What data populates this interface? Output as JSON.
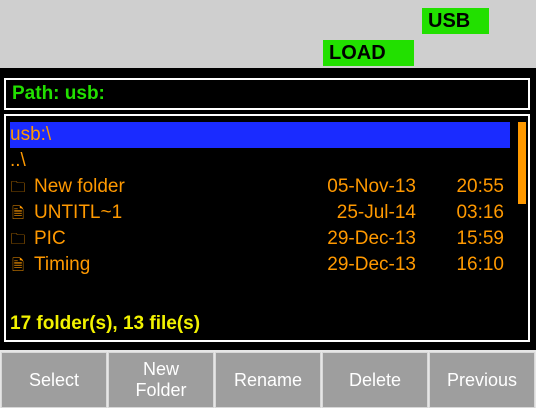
{
  "status": {
    "usb": "USB",
    "load": "LOAD"
  },
  "path": {
    "label": "Path:",
    "value": "usb:"
  },
  "browser": {
    "current_dir": "usb:\\",
    "parent": "..\\",
    "entries": [
      {
        "type": "folder",
        "icon": "folder-icon",
        "name": "New folder",
        "date": "05-Nov-13",
        "time": "20:55"
      },
      {
        "type": "file",
        "icon": "file-icon",
        "name": "UNTITL~1",
        "date": "25-Jul-14",
        "time": "03:16"
      },
      {
        "type": "folder",
        "icon": "folder-icon",
        "name": "PIC",
        "date": "29-Dec-13",
        "time": "15:59"
      },
      {
        "type": "file",
        "icon": "file-icon",
        "name": "Timing",
        "date": "29-Dec-13",
        "time": "16:10"
      }
    ],
    "summary": "17 folder(s), 13 file(s)"
  },
  "softkeys": [
    {
      "label": "Select"
    },
    {
      "label": "New Folder"
    },
    {
      "label": "Rename"
    },
    {
      "label": "Delete"
    },
    {
      "label": "Previous"
    }
  ],
  "colors": {
    "status_badge": "#22e000",
    "path_text": "#22e000",
    "list_text": "#ff9900",
    "selection": "#1a2bff",
    "summary_text": "#f2f200",
    "softkey_bg": "#9e9e9e"
  }
}
